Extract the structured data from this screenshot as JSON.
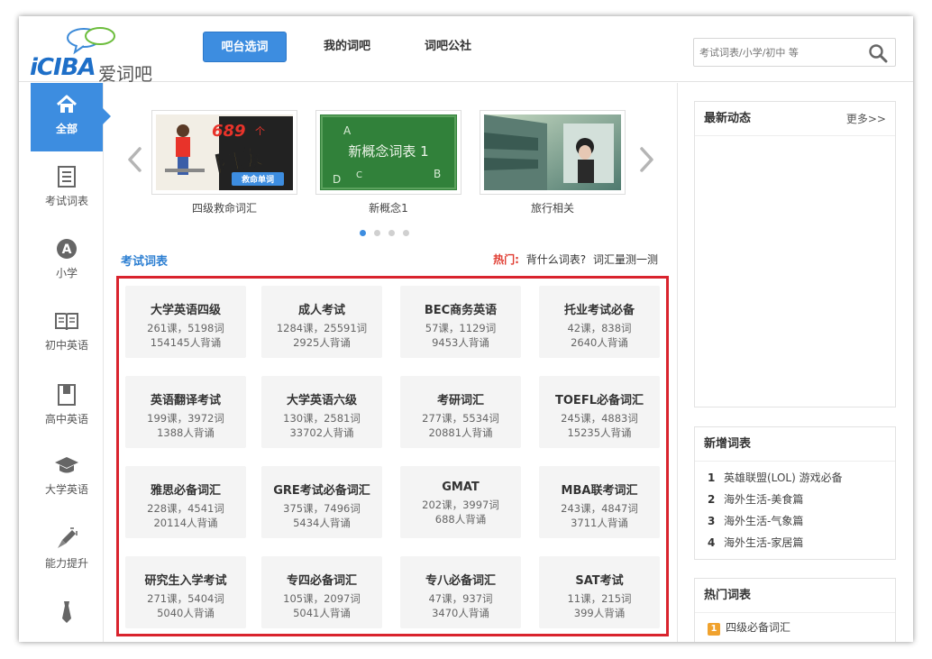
{
  "header": {
    "logo_text": "iCIBA",
    "logo_cn": "爱词吧",
    "nav": [
      {
        "label": "吧台选词",
        "active": true
      },
      {
        "label": "我的词吧",
        "active": false
      },
      {
        "label": "词吧公社",
        "active": false
      }
    ],
    "search": {
      "placeholder": "考试词表/小学/初中 等"
    }
  },
  "sidebar": {
    "items": [
      {
        "label": "全部",
        "icon": "home-icon",
        "active": true
      },
      {
        "label": "考试词表",
        "icon": "document-icon"
      },
      {
        "label": "小学",
        "icon": "letter-a-icon"
      },
      {
        "label": "初中英语",
        "icon": "open-book-icon"
      },
      {
        "label": "高中英语",
        "icon": "closed-book-icon"
      },
      {
        "label": "大学英语",
        "icon": "graduation-cap-icon"
      },
      {
        "label": "能力提升",
        "icon": "rocket-icon"
      },
      {
        "label": "",
        "icon": "necktie-icon"
      }
    ]
  },
  "carousel": {
    "slides": [
      {
        "caption": "四级救命词汇",
        "big_num": "689",
        "big_unit": "个",
        "big_word": "四级",
        "tag": "救命单词"
      },
      {
        "caption": "新概念1",
        "board_text": "新概念词表 1",
        "letters": [
          "A",
          "B",
          "C",
          "D"
        ]
      },
      {
        "caption": "旅行相关"
      }
    ],
    "dot_count": 4,
    "active_dot": 0
  },
  "section": {
    "title": "考试词表",
    "hot_label": "热门:",
    "hot_links": [
      "背什么词表?",
      "词汇量测一测"
    ]
  },
  "cards": [
    {
      "title": "大学英语四级",
      "line1": "261课，5198词",
      "line2": "154145人背诵"
    },
    {
      "title": "成人考试",
      "line1": "1284课，25591词",
      "line2": "2925人背诵"
    },
    {
      "title": "BEC商务英语",
      "line1": "57课，1129词",
      "line2": "9453人背诵"
    },
    {
      "title": "托业考试必备",
      "line1": "42课，838词",
      "line2": "2640人背诵"
    },
    {
      "title": "英语翻译考试",
      "line1": "199课，3972词",
      "line2": "1388人背诵"
    },
    {
      "title": "大学英语六级",
      "line1": "130课，2581词",
      "line2": "33702人背诵"
    },
    {
      "title": "考研词汇",
      "line1": "277课，5534词",
      "line2": "20881人背诵"
    },
    {
      "title": "TOEFL必备词汇",
      "line1": "245课，4883词",
      "line2": "15235人背诵"
    },
    {
      "title": "雅思必备词汇",
      "line1": "228课，4541词",
      "line2": "20114人背诵"
    },
    {
      "title": "GRE考试必备词汇",
      "line1": "375课，7496词",
      "line2": "5434人背诵"
    },
    {
      "title": "GMAT",
      "line1": "202课，3997词",
      "line2": "688人背诵"
    },
    {
      "title": "MBA联考词汇",
      "line1": "243课，4847词",
      "line2": "3711人背诵"
    },
    {
      "title": "研究生入学考试",
      "line1": "271课，5404词",
      "line2": "5040人背诵"
    },
    {
      "title": "专四必备词汇",
      "line1": "105课，2097词",
      "line2": "5041人背诵"
    },
    {
      "title": "专八必备词汇",
      "line1": "47课，937词",
      "line2": "3470人背诵"
    },
    {
      "title": "SAT考试",
      "line1": "11课，215词",
      "line2": "399人背诵"
    }
  ],
  "right": {
    "news": {
      "title": "最新动态",
      "more": "更多>>"
    },
    "new_lists": {
      "title": "新增词表",
      "items": [
        {
          "num": "1",
          "label": "英雄联盟(LOL) 游戏必备"
        },
        {
          "num": "2",
          "label": "海外生活-美食篇"
        },
        {
          "num": "3",
          "label": "海外生活-气象篇"
        },
        {
          "num": "4",
          "label": "海外生活-家居篇"
        }
      ]
    },
    "hot_lists": {
      "title": "热门词表",
      "items": [
        {
          "num": "1",
          "label": "四级必备词汇"
        }
      ]
    }
  },
  "colors": {
    "accent": "#3d8de0",
    "highlight_border": "#d9232d",
    "hot_label": "#e03c31",
    "badge": "#f0a22e"
  }
}
